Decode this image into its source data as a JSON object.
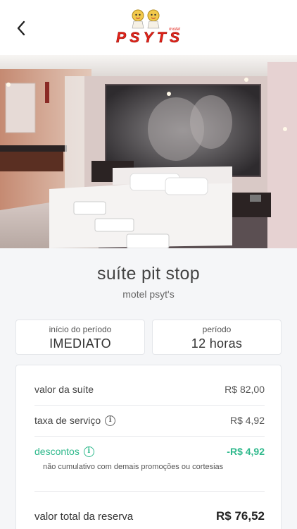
{
  "header": {
    "back_icon": "chevron-left-icon",
    "logo": {
      "name": "PSYTS",
      "sub": "motel"
    }
  },
  "gallery": {
    "slide_count": 13,
    "active_index": 0
  },
  "suite": {
    "name": "suíte pit stop",
    "motel": "motel psyt's"
  },
  "booking": {
    "start_label": "início do período",
    "start_value": "IMEDIATO",
    "period_label": "período",
    "period_value": "12 horas"
  },
  "pricing": {
    "suite_label": "valor da suíte",
    "suite_value": "R$ 82,00",
    "fee_label": "taxa de serviço",
    "fee_value": "R$ 4,92",
    "discount_label": "descontos",
    "discount_value": "-R$ 4,92",
    "discount_note": "não cumulativo com demais promoções ou cortesias",
    "total_label": "valor total da reserva",
    "total_value": "R$ 76,52"
  },
  "colors": {
    "accent_green": "#2fb98c",
    "logo_red": "#e2231a"
  }
}
